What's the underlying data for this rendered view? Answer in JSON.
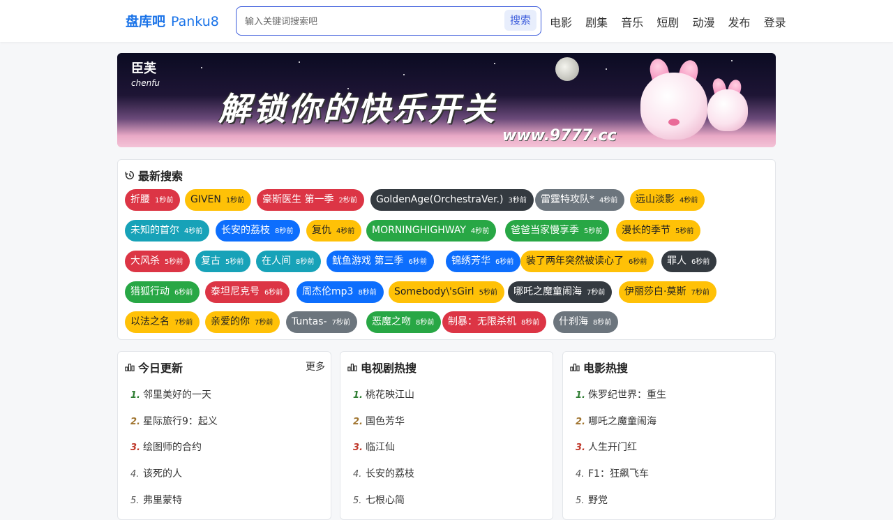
{
  "header": {
    "logo": "盘库吧",
    "logo_sub": "Panku8",
    "search_placeholder": "输入关键词搜索吧",
    "search_button": "搜索",
    "nav": [
      "电影",
      "剧集",
      "音乐",
      "短剧",
      "动漫",
      "发布",
      "登录"
    ]
  },
  "banner": {
    "brand": "臣芙",
    "brand_en": "chenfu",
    "slogan": "解锁你的快乐开关",
    "url": "www.9777.cc"
  },
  "recent": {
    "title": "最新搜索",
    "tags": [
      {
        "label": "折腰",
        "time": "1秒前",
        "color": "#dc3545"
      },
      {
        "label": "GIVEN",
        "time": "1秒前",
        "color": "#ffc107"
      },
      {
        "label": "豪斯医生 第一季",
        "time": "2秒前",
        "color": "#dc3545"
      },
      {
        "label": "GoldenAge(OrchestraVer.)",
        "time": "3秒前",
        "color": "#343a40"
      },
      {
        "label": "雷霆特攻队*",
        "time": "4秒前",
        "color": "#6c757d"
      },
      {
        "label": "远山淡影",
        "time": "4秒前",
        "color": "#ffc107"
      },
      {
        "label": "未知的首尔",
        "time": "4秒前",
        "color": "#17a2b8"
      },
      {
        "label": "长安的荔枝",
        "time": "8秒前",
        "color": "#0d6efd"
      },
      {
        "label": "复仇",
        "time": "4秒前",
        "color": "#ffc107"
      },
      {
        "label": "MORNINGHIGHWAY",
        "time": "4秒前",
        "color": "#28a745"
      },
      {
        "label": "爸爸当家慢享季",
        "time": "5秒前",
        "color": "#28a745"
      },
      {
        "label": "漫长的季节",
        "time": "5秒前",
        "color": "#ffc107"
      },
      {
        "label": "大风杀",
        "time": "5秒前",
        "color": "#dc3545"
      },
      {
        "label": "复古",
        "time": "5秒前",
        "color": "#17a2b8"
      },
      {
        "label": "在人间",
        "time": "8秒前",
        "color": "#17a2b8"
      },
      {
        "label": "鱿鱼游戏 第三季",
        "time": "6秒前",
        "color": "#0d6efd"
      },
      {
        "label": "锦绣芳华",
        "time": "6秒前",
        "color": "#0d6efd"
      },
      {
        "label": "装了两年突然被读心了",
        "time": "6秒前",
        "color": "#ffc107"
      },
      {
        "label": "罪人",
        "time": "6秒前",
        "color": "#343a40"
      },
      {
        "label": "猎狐行动",
        "time": "6秒前",
        "color": "#28a745"
      },
      {
        "label": "泰坦尼克号",
        "time": "6秒前",
        "color": "#dc3545"
      },
      {
        "label": "周杰伦mp3",
        "time": "8秒前",
        "color": "#0d6efd"
      },
      {
        "label": "Somebody\\'sGirl",
        "time": "5秒前",
        "color": "#ffc107"
      },
      {
        "label": "哪吒之魔童闹海",
        "time": "7秒前",
        "color": "#343a40"
      },
      {
        "label": "伊丽莎白·莫斯",
        "time": "7秒前",
        "color": "#ffc107"
      },
      {
        "label": "以法之名",
        "time": "7秒前",
        "color": "#ffc107"
      },
      {
        "label": "亲爱的你",
        "time": "7秒前",
        "color": "#ffc107"
      },
      {
        "label": "Tuntas-",
        "time": "7秒前",
        "color": "#6c757d"
      },
      {
        "label": "恶魔之吻",
        "time": "8秒前",
        "color": "#28a745"
      },
      {
        "label": "制暴：无限杀机",
        "time": "8秒前",
        "color": "#dc3545"
      },
      {
        "label": "什刹海",
        "time": "8秒前",
        "color": "#6c757d"
      }
    ]
  },
  "today": {
    "title": "今日更新",
    "more": "更多",
    "items": [
      {
        "num": "1.",
        "title": "邻里美好的一天"
      },
      {
        "num": "2.",
        "title": "星际旅行9：起义"
      },
      {
        "num": "3.",
        "title": "绘图师的合约"
      },
      {
        "num": "4.",
        "title": "该死的人"
      },
      {
        "num": "5.",
        "title": "弗里蒙特"
      }
    ]
  },
  "tv": {
    "title": "电视剧热搜",
    "items": [
      {
        "num": "1.",
        "title": "桃花映江山"
      },
      {
        "num": "2.",
        "title": "国色芳华"
      },
      {
        "num": "3.",
        "title": "临江仙"
      },
      {
        "num": "4.",
        "title": "长安的荔枝"
      },
      {
        "num": "5.",
        "title": "七根心简"
      }
    ]
  },
  "movies": {
    "title": "电影热搜",
    "items": [
      {
        "num": "1.",
        "title": "侏罗纪世界：重生"
      },
      {
        "num": "2.",
        "title": "哪吒之魔童闹海"
      },
      {
        "num": "3.",
        "title": "人生开门红"
      },
      {
        "num": "4.",
        "title": "F1：狂飙飞车"
      },
      {
        "num": "5.",
        "title": "野党"
      }
    ]
  }
}
